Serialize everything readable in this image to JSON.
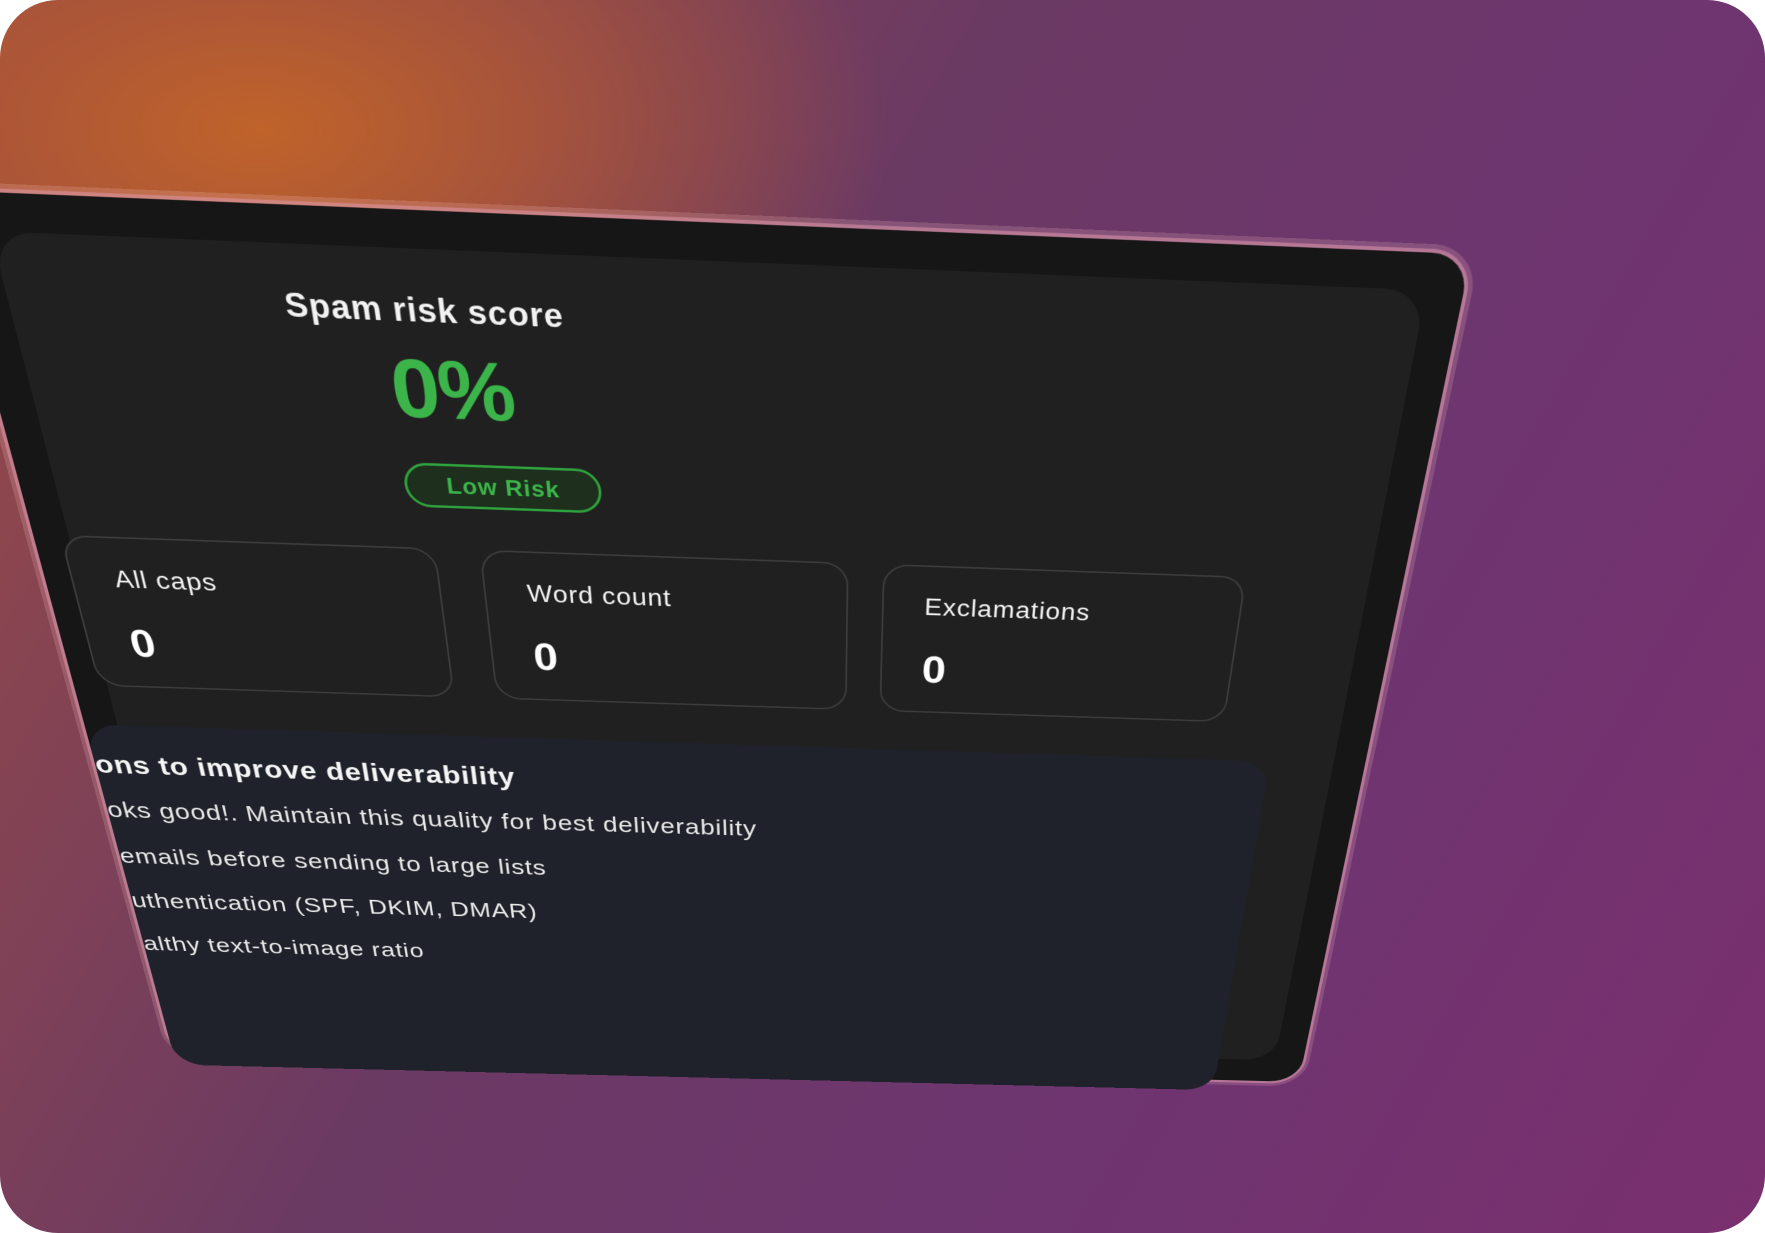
{
  "score": {
    "title": "Spam risk score",
    "value": "0%",
    "badge": "Low Risk"
  },
  "stats": [
    {
      "label": "All caps",
      "value": "0"
    },
    {
      "label": "Word count",
      "value": "0"
    },
    {
      "label": "Exclamations",
      "value": "0"
    }
  ],
  "tips": {
    "title": "ons to improve deliverability",
    "items": [
      "oks good!. Maintain this quality for best deliverability",
      "emails before sending to large lists",
      "uthentication (SPF, DKIM, DMAR)",
      "althy text-to-image ratio"
    ]
  },
  "colors": {
    "accent_green": "#3bb54a",
    "panel_bg": "#202020",
    "tips_bg": "#1f222a"
  }
}
